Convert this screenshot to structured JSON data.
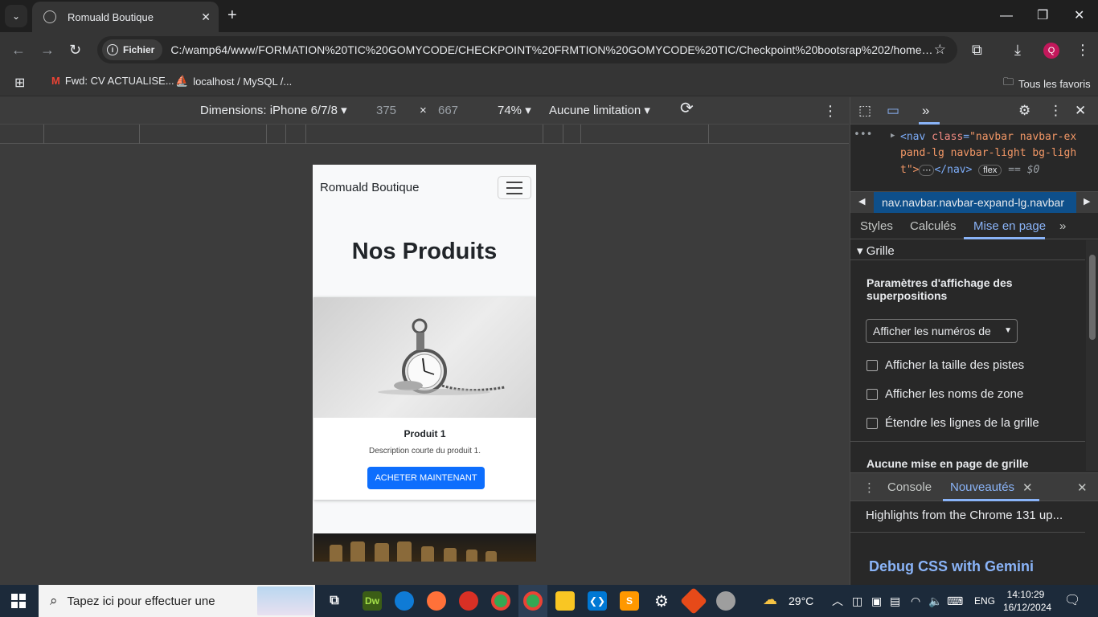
{
  "browser": {
    "tab_title": "Romuald Boutique",
    "url_chip": "Fichier",
    "url": "C:/wamp64/www/FORMATION%20TIC%20GOMYCODE/CHECKPOINT%20FRMTION%20GOMYCODE%20TIC/Checkpoint%20bootsrap%202/home-bouti...",
    "profile_initial": "Q",
    "bookmarks": [
      {
        "label": "Fwd: CV ACTUALISE..."
      },
      {
        "label": "localhost / MySQL /..."
      }
    ],
    "all_bookmarks": "Tous les favoris"
  },
  "device_toolbar": {
    "dimensions": "Dimensions: iPhone 6/7/8",
    "width": "375",
    "times": "×",
    "height": "667",
    "zoom": "74%",
    "throttle": "Aucune limitation"
  },
  "page": {
    "brand": "Romuald Boutique",
    "heading": "Nos Produits",
    "product": {
      "title": "Produit 1",
      "description": "Description courte du produit 1.",
      "button": "ACHETER MAINTENANT"
    }
  },
  "devtools": {
    "dom_line1_tag": "<nav",
    "dom_line1_attr": "class",
    "dom_line1_val": "\"navbar navbar-ex",
    "dom_line2_val": "pand-lg navbar-light bg-ligh",
    "dom_line3_val": "t\">",
    "dom_line3_close": "</nav>",
    "dom_badge": "flex",
    "dom_eq": "== $0",
    "breadcrumb": "nav.navbar.navbar-expand-lg.navbar",
    "subtabs": [
      "Styles",
      "Calculés",
      "Mise en page"
    ],
    "section": "Grille",
    "overlay_heading": "Paramètres d'affichage des superpositions",
    "select_value": "Afficher les numéros de",
    "checkboxes": [
      "Afficher la taille des pistes",
      "Afficher les noms de zone",
      "Étendre les lignes de la grille"
    ],
    "no_grid": "Aucune mise en page de grille",
    "drawer_tabs": [
      "Console",
      "Nouveautés"
    ],
    "whatsnew_line": "Highlights from the Chrome 131 up...",
    "whatsnew_title": "Debug CSS with Gemini"
  },
  "taskbar": {
    "search_placeholder": "Tapez ici pour effectuer une",
    "weather": "29°C",
    "lang": "ENG",
    "time": "14:10:29",
    "date": "16/12/2024"
  }
}
